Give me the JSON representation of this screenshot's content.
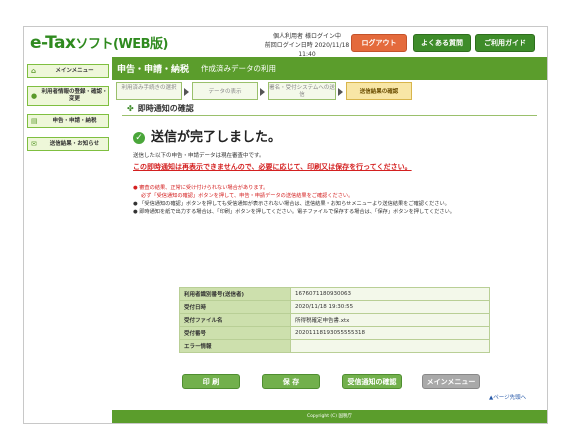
{
  "header": {
    "logo_main": "e-Tax",
    "logo_sub": "ソフト(WEB版)",
    "login_status": "個人利用者 様ログイン中",
    "last_login": "前回ログイン日時 2020/11/18 11:40",
    "logout_label": "ログアウト",
    "faq_label": "よくある質問",
    "guide_label": "ご利用ガイド"
  },
  "sidebar": {
    "items": [
      {
        "label": "メインメニュー"
      },
      {
        "label": "利用者情報の登録・確認・変更"
      },
      {
        "label": "申告・申請・納税"
      },
      {
        "label": "送信結果・お知らせ"
      }
    ]
  },
  "page": {
    "title": "申告・申請・納税",
    "subtitle": "作成済みデータの利用"
  },
  "steps": [
    {
      "label": "利用済み手続きの選択"
    },
    {
      "label": "データの表示"
    },
    {
      "label": "署名・受付システムへの送信"
    },
    {
      "label": "送信結果の確認"
    }
  ],
  "section": {
    "title": "即時通知の確認",
    "done_message": "送信が完了しました。",
    "lead": "送信した以下の申告・申請データは現在審査中です。",
    "warning": "この即時通知は再表示できませんので、必要に応じて、印刷又は保存を行ってください。",
    "note1a": "審査の結果、正常に受け付けられない場合があります。",
    "note1b": "必ず「受信通知の確認」ボタンを押して、申告・申請データの送信結果をご確認ください。",
    "note2": "「受信通知の確認」ボタンを押しても受信通知が表示されない場合は、送信結果・お知らせメニューより送信結果をご確認ください。",
    "note3": "即時通知を紙で出力する場合は、「印刷」ボタンを押してください。電子ファイルで保存する場合は、「保存」ボタンを押してください。"
  },
  "info_table": [
    {
      "key": "利用者識別番号(送信者)",
      "value": "1676071180930063"
    },
    {
      "key": "受付日時",
      "value": "2020/11/18 19:30:55"
    },
    {
      "key": "受付ファイル名",
      "value": "所得税確定申告書.xtx"
    },
    {
      "key": "受付番号",
      "value": "20201118193055555318"
    },
    {
      "key": "エラー情報",
      "value": ""
    }
  ],
  "actions": {
    "print_label": "印 刷",
    "save_label": "保 存",
    "receipt_label": "受信通知の確認",
    "menu_label": "メインメニュー"
  },
  "page_top_label": "ページ先頭へ",
  "footer_text": "Copyright (C) 国税庁",
  "colors": {
    "brand_green": "#5b9d2c",
    "logout_orange": "#e46a3c",
    "warning_red": "#d42020"
  }
}
